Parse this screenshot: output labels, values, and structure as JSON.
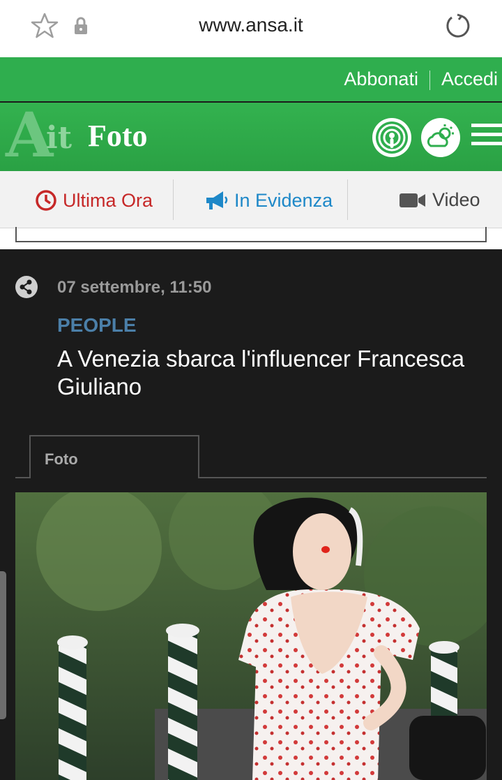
{
  "browser": {
    "url": "www.ansa.it",
    "icons": [
      "star-icon",
      "lock-icon",
      "reload-icon"
    ]
  },
  "account": {
    "subscribe_label": "Abbonati",
    "login_label": "Accedi"
  },
  "brand": {
    "logo_letter": "A",
    "logo_suffix": "it",
    "section_title": "Foto",
    "colors": {
      "green": "#2fae4e",
      "logo_green": "#6cc67f"
    }
  },
  "nav": {
    "items": [
      {
        "label": "Ultima Ora",
        "icon": "clock-icon",
        "color": "#c62828"
      },
      {
        "label": "In Evidenza",
        "icon": "megaphone-icon",
        "color": "#1e88c8"
      },
      {
        "label": "Video",
        "icon": "video-camera-icon",
        "color": "#444444"
      }
    ]
  },
  "article": {
    "date": "07 settembre, 11:50",
    "category": "PEOPLE",
    "headline": "A Venezia sbarca l'influencer Francesca Giuliano",
    "tab_label": "Foto",
    "category_color": "#4b7fa8"
  }
}
